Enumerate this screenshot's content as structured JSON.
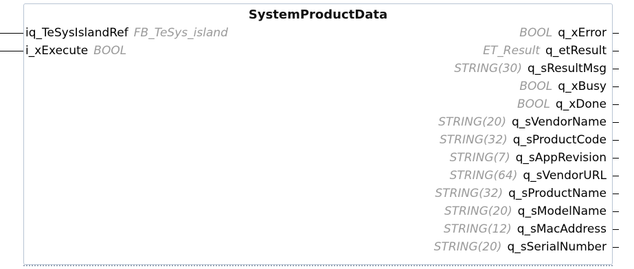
{
  "block": {
    "title": "SystemProductData"
  },
  "inputs": [
    {
      "name": "iq_TeSysIslandRef",
      "type": "FB_TeSys_island"
    },
    {
      "name": "i_xExecute",
      "type": "BOOL"
    }
  ],
  "outputs": [
    {
      "name": "q_xError",
      "type": "BOOL"
    },
    {
      "name": "q_etResult",
      "type": "ET_Result"
    },
    {
      "name": "q_sResultMsg",
      "type": "STRING(30)"
    },
    {
      "name": "q_xBusy",
      "type": "BOOL"
    },
    {
      "name": "q_xDone",
      "type": "BOOL"
    },
    {
      "name": "q_sVendorName",
      "type": "STRING(20)"
    },
    {
      "name": "q_sProductCode",
      "type": "STRING(32)"
    },
    {
      "name": "q_sAppRevision",
      "type": "STRING(7)"
    },
    {
      "name": "q_sVendorURL",
      "type": "STRING(64)"
    },
    {
      "name": "q_sProductName",
      "type": "STRING(32)"
    },
    {
      "name": "q_sModelName",
      "type": "STRING(20)"
    },
    {
      "name": "q_sMacAddress",
      "type": "STRING(12)"
    },
    {
      "name": "q_sSerialNumber",
      "type": "STRING(20)"
    }
  ]
}
